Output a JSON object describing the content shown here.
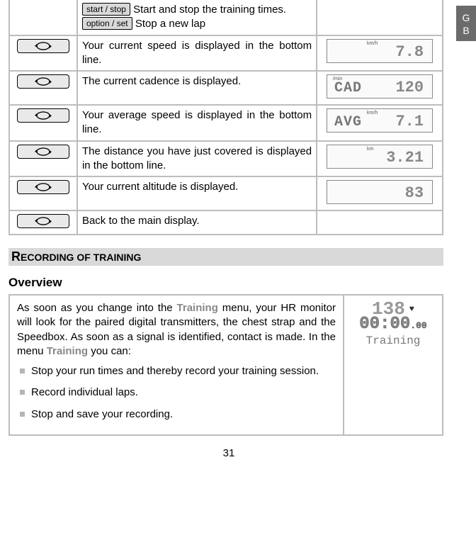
{
  "lang_tab": "G\nB",
  "top_instructions": {
    "key1": "start / stop",
    "text1": " Start and stop the training times.",
    "key2": "option / set",
    "text2": " Stop a new lap"
  },
  "rows": [
    {
      "desc": "Your current speed is displayed in the bottom line.",
      "lcd": {
        "unit": "km/h",
        "unit_side": "mid",
        "label": "",
        "value": "7.8"
      }
    },
    {
      "desc": "The current cadence is displayed.",
      "lcd": {
        "unit": "/min",
        "unit_side": "left",
        "label": "CAD",
        "value": "120"
      }
    },
    {
      "desc": "Your average speed is displayed in the bottom line.",
      "lcd": {
        "unit": "km/h",
        "unit_side": "mid",
        "label": "AVG",
        "value": "7.1"
      }
    },
    {
      "desc": "The distance you have just covered is displayed in the bottom line.",
      "lcd": {
        "unit": "km",
        "unit_side": "mid",
        "label": "",
        "value": "3.21"
      }
    },
    {
      "desc": "Your current altitude is displayed.",
      "lcd": {
        "unit": "",
        "unit_side": "mid",
        "label": "",
        "value": "83"
      }
    },
    {
      "desc": "Back to the main display.",
      "lcd": null
    }
  ],
  "section_title": "RECORDING OF TRAINING",
  "subheading": "Overview",
  "overview": {
    "para_a": "As soon as you change into the ",
    "menu1": "Training",
    "para_b": " menu, your HR monitor will look for the paired digital transmitters, the chest strap and the Speedbox. As soon as a signal is identified, contact is made. In the menu ",
    "menu2": "Training",
    "para_c": " you can:",
    "bullets": [
      "Stop your run times and thereby record your training session.",
      "Record individual laps.",
      "Stop and save your recording."
    ],
    "lcd": {
      "hr": "138",
      "time": "00:00",
      "time_sub": ".00",
      "mode": "Training"
    }
  },
  "page_number": "31"
}
